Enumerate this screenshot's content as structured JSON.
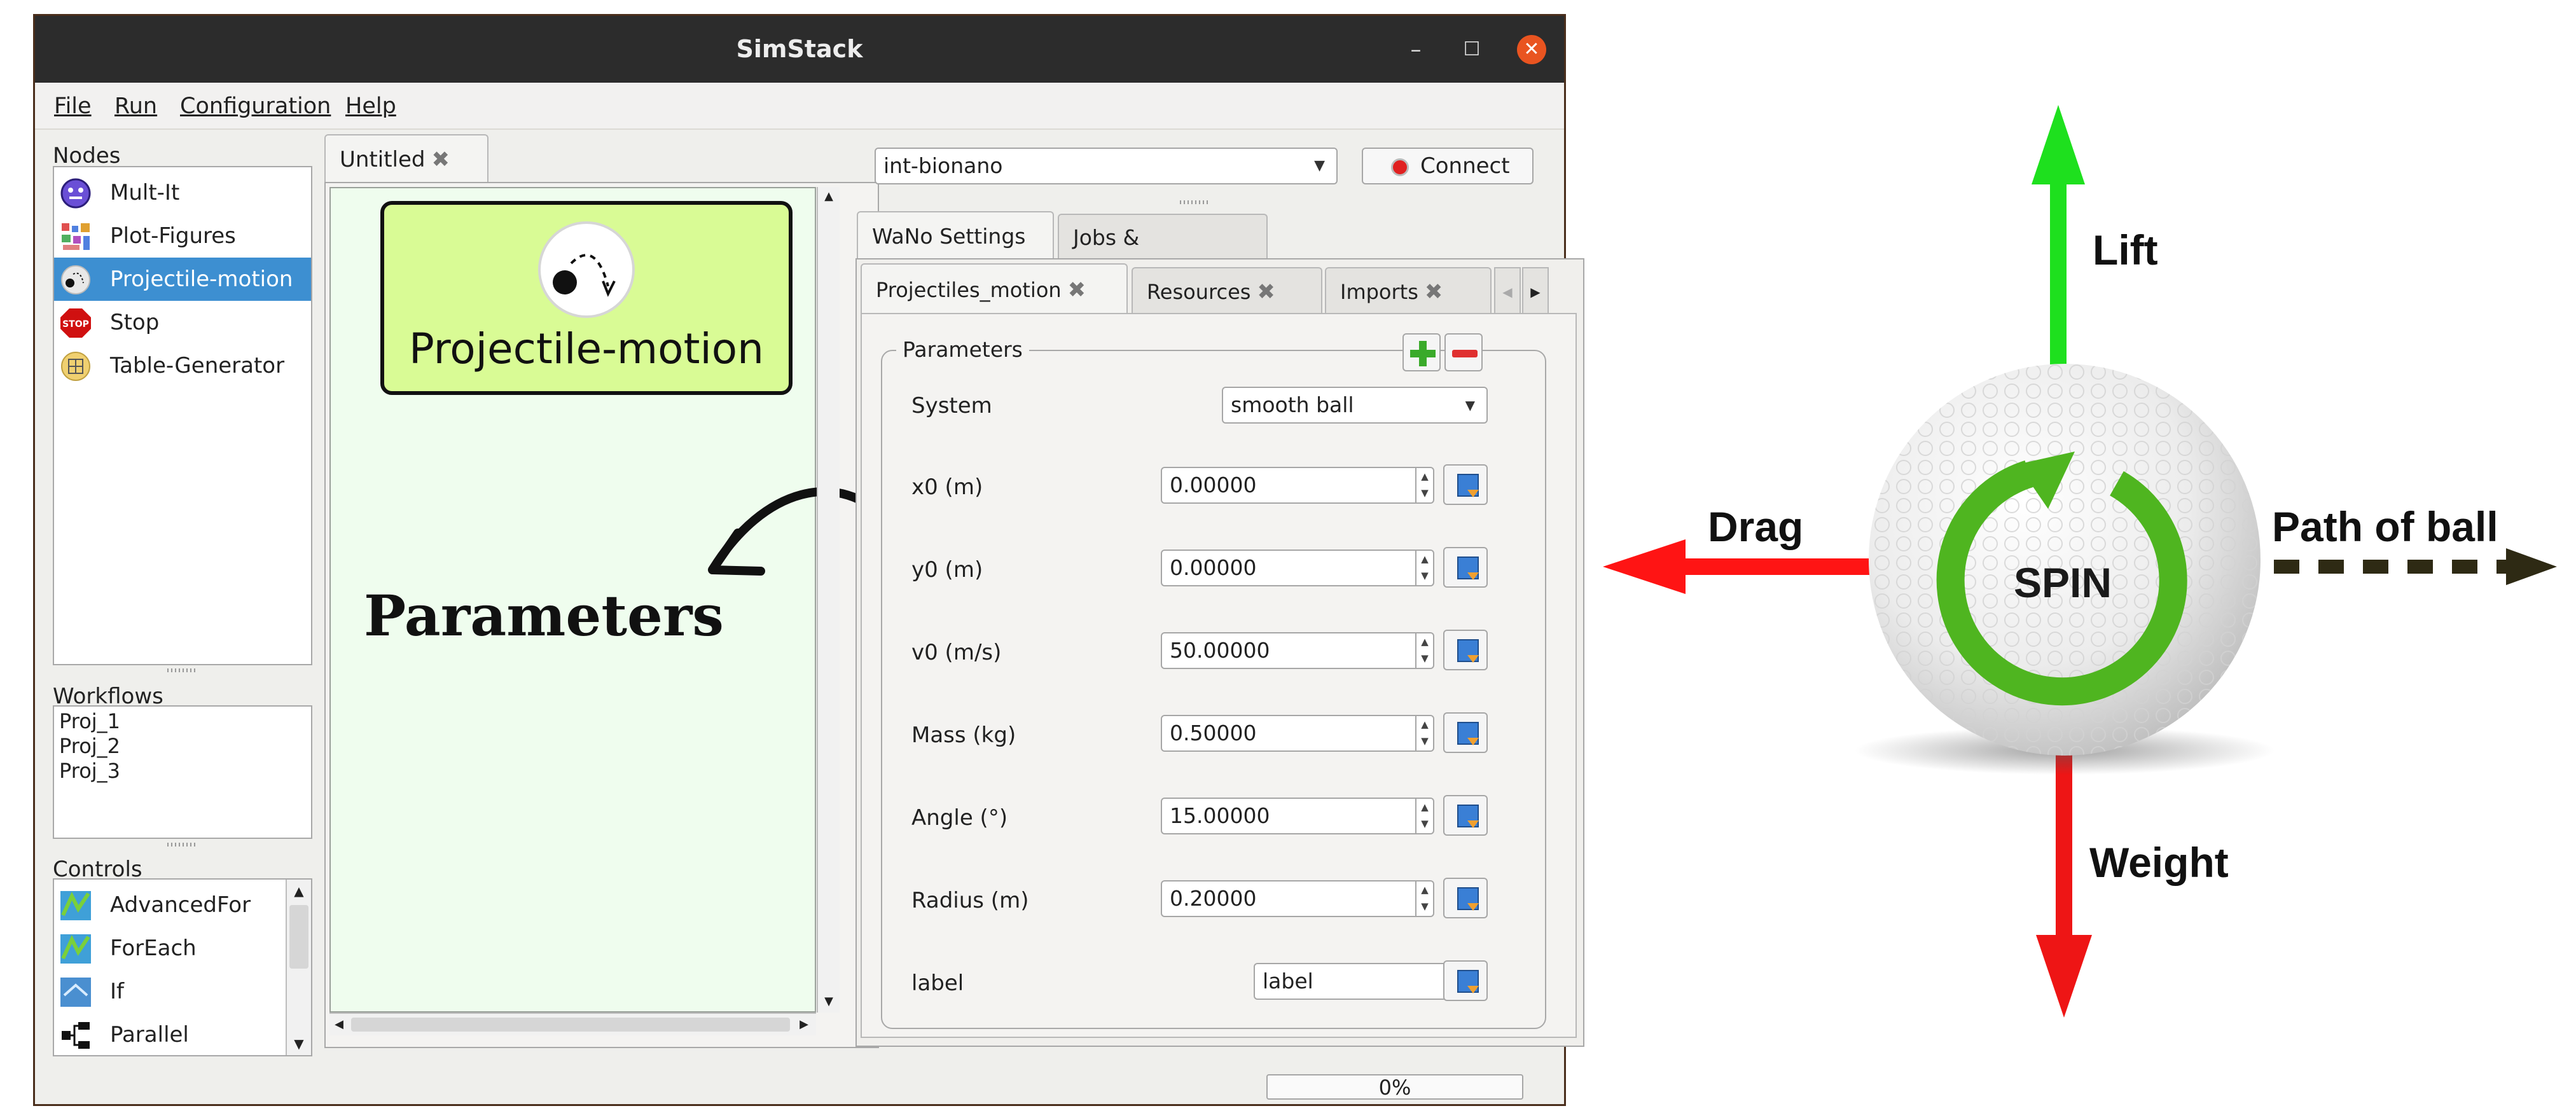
{
  "window": {
    "title": "SimStack",
    "minimize": "–",
    "maximize": "☐",
    "close": "✕"
  },
  "menu": [
    "File",
    "Run",
    "Configuration",
    "Help"
  ],
  "sidebar": {
    "nodes_label": "Nodes",
    "nodes": [
      {
        "label": "Mult-It",
        "icon": "mult-it-icon"
      },
      {
        "label": "Plot-Figures",
        "icon": "plot-figures-icon"
      },
      {
        "label": "Projectile-motion",
        "icon": "projectile-icon",
        "selected": true
      },
      {
        "label": "Stop",
        "icon": "stop-icon"
      },
      {
        "label": "Table-Generator",
        "icon": "table-generator-icon"
      }
    ],
    "workflows_label": "Workflows",
    "workflows": [
      "Proj_1",
      "Proj_2",
      "Proj_3"
    ],
    "controls_label": "Controls",
    "controls": [
      {
        "label": "AdvancedFor",
        "icon": "advanced-for-icon"
      },
      {
        "label": "ForEach",
        "icon": "foreach-icon"
      },
      {
        "label": "If",
        "icon": "if-icon"
      },
      {
        "label": "Parallel",
        "icon": "parallel-icon"
      }
    ]
  },
  "canvas": {
    "tab_label": "Untitled",
    "tab_close": "✖",
    "node_label": "Projectile-motion",
    "annotation": "Parameters"
  },
  "server": {
    "selected": "int-bionano",
    "connect_label": "Connect",
    "status_color": "#e02020"
  },
  "settings": {
    "tabs": [
      "WaNo Settings",
      "Jobs & Workflows"
    ],
    "subtabs": [
      "Projectiles_motion",
      "Resources",
      "Imports"
    ],
    "group_title": "Parameters",
    "system_label": "System",
    "system_value": "smooth ball",
    "params": [
      {
        "label": "x0 (m)",
        "value": "0.00000"
      },
      {
        "label": "y0 (m)",
        "value": "0.00000"
      },
      {
        "label": "v0 (m/s)",
        "value": "50.00000"
      },
      {
        "label": "Mass (kg)",
        "value": "0.50000"
      },
      {
        "label": "Angle (°)",
        "value": "15.00000"
      },
      {
        "label": "Radius (m)",
        "value": "0.20000"
      }
    ],
    "label_field": {
      "label": "label",
      "value": "label"
    }
  },
  "status": {
    "progress_text": "0%",
    "progress": 0
  },
  "diagram": {
    "lift": "Lift",
    "drag": "Drag",
    "weight": "Weight",
    "path": "Path of ball",
    "spin": "SPIN",
    "colors": {
      "lift": "#1ee01e",
      "drag": "#ff1414",
      "weight": "#ee1515",
      "path": "#2e2a14",
      "spin": "#4fb520"
    }
  }
}
